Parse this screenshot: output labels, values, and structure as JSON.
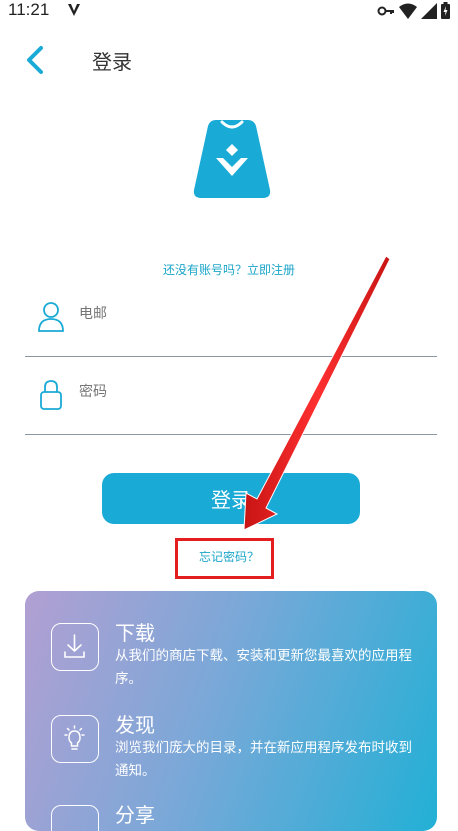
{
  "status_bar": {
    "time": "11:21"
  },
  "header": {
    "title": "登录"
  },
  "register_link": "还没有账号吗？立即注册",
  "email_field": {
    "placeholder": "电邮"
  },
  "password_field": {
    "placeholder": "密码"
  },
  "login_button": "登录",
  "forgot_password": "忘记密码？",
  "features": [
    {
      "icon": "download-icon",
      "title": "下载",
      "desc": "从我们的商店下载、安装和更新您最喜欢的应用程序。"
    },
    {
      "icon": "lightbulb-icon",
      "title": "发现",
      "desc": "浏览我们庞大的目录，并在新应用程序发布时收到通知。"
    },
    {
      "icon": "share-icon",
      "title": "分享",
      "desc": ""
    }
  ],
  "colors": {
    "accent": "#1aaad6",
    "highlight": "#e41e1e"
  }
}
